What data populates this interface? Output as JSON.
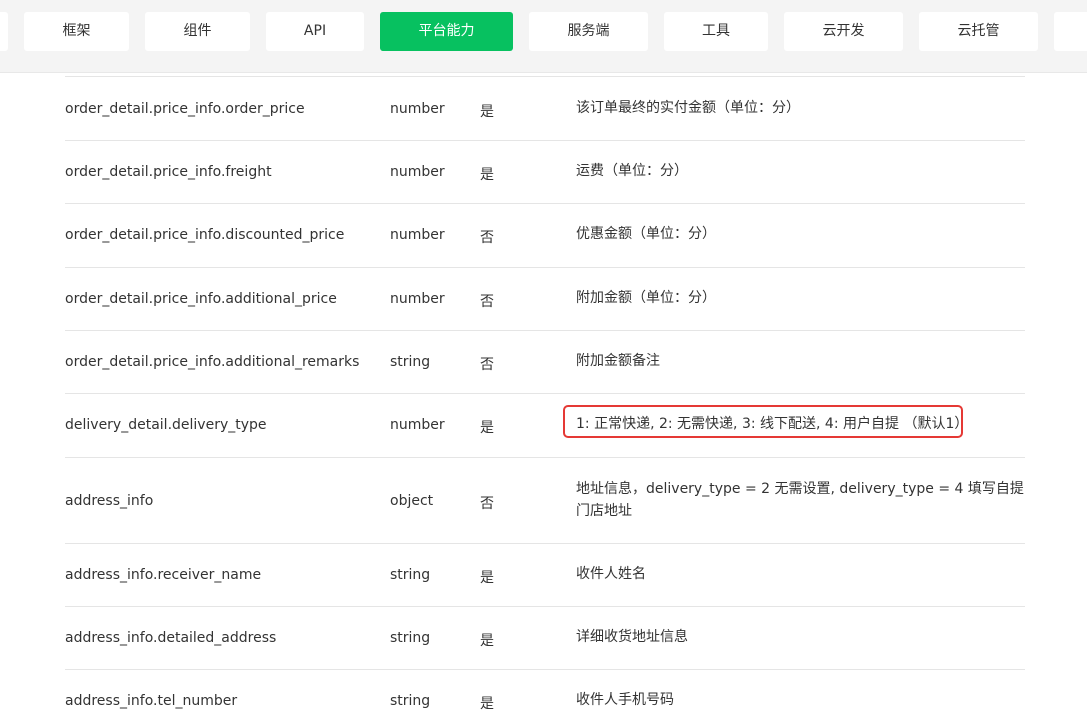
{
  "nav": {
    "tabs": [
      {
        "label": "",
        "active": false
      },
      {
        "label": "框架",
        "active": false
      },
      {
        "label": "组件",
        "active": false
      },
      {
        "label": "API",
        "active": false
      },
      {
        "label": "平台能力",
        "active": true
      },
      {
        "label": "服务端",
        "active": false
      },
      {
        "label": "工具",
        "active": false
      },
      {
        "label": "云开发",
        "active": false
      },
      {
        "label": "云托管",
        "active": false
      },
      {
        "label": "",
        "active": false
      }
    ]
  },
  "table": {
    "rows": [
      {
        "name": "order_detail.price_info.order_price",
        "type": "number",
        "required": "是",
        "desc": "该订单最终的实付金额（单位：分）"
      },
      {
        "name": "order_detail.price_info.freight",
        "type": "number",
        "required": "是",
        "desc": "运费（单位：分）"
      },
      {
        "name": "order_detail.price_info.discounted_price",
        "type": "number",
        "required": "否",
        "desc": "优惠金额（单位：分）"
      },
      {
        "name": "order_detail.price_info.additional_price",
        "type": "number",
        "required": "否",
        "desc": "附加金额（单位：分）"
      },
      {
        "name": "order_detail.price_info.additional_remarks",
        "type": "string",
        "required": "否",
        "desc": "附加金额备注"
      },
      {
        "name": "delivery_detail.delivery_type",
        "type": "number",
        "required": "是",
        "desc": "1: 正常快递, 2: 无需快递, 3: 线下配送, 4: 用户自提 （默认1）"
      },
      {
        "name": "address_info",
        "type": "object",
        "required": "否",
        "desc": "地址信息，delivery_type = 2 无需设置, delivery_type = 4 填写自提门店地址"
      },
      {
        "name": "address_info.receiver_name",
        "type": "string",
        "required": "是",
        "desc": "收件人姓名"
      },
      {
        "name": "address_info.detailed_address",
        "type": "string",
        "required": "是",
        "desc": "详细收货地址信息"
      },
      {
        "name": "address_info.tel_number",
        "type": "string",
        "required": "是",
        "desc": "收件人手机号码"
      }
    ]
  },
  "highlight_color": "#e53935",
  "accent_color": "#07c160"
}
